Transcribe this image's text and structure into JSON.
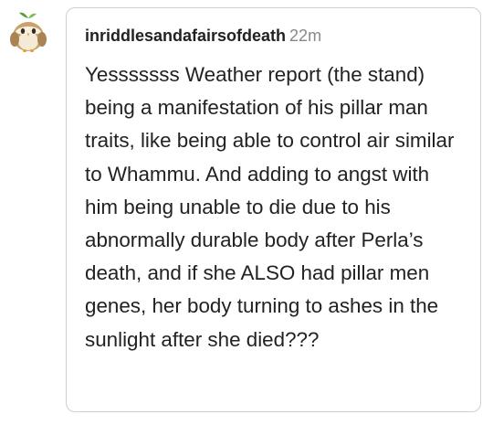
{
  "message": {
    "avatar_icon": "owl-avatar-icon",
    "username": "inriddlesandafairsofdeath",
    "timestamp": "22m",
    "text": "Yesssssss Weather report (the stand) being a manifestation of his pillar man traits, like being able to control air similar to Whammu. And adding to angst with him being unable to die due to his abnormally durable body after Perla’s death, and if she ALSO had pillar men genes, her body turning to ashes in the sunlight after she died???"
  },
  "colors": {
    "username": "#222222",
    "timestamp": "#888888",
    "border": "#cfcfcf",
    "text": "#222222"
  }
}
